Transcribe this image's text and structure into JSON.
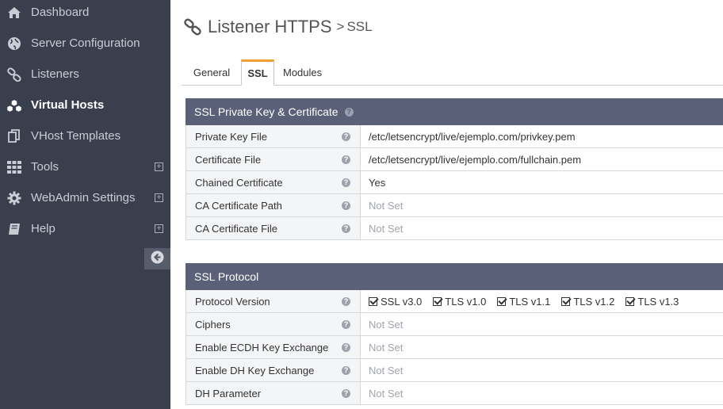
{
  "sidebar": {
    "items": [
      {
        "label": "Dashboard",
        "icon": "home-icon"
      },
      {
        "label": "Server Configuration",
        "icon": "globe-icon"
      },
      {
        "label": "Listeners",
        "icon": "link-icon"
      },
      {
        "label": "Virtual Hosts",
        "icon": "cubes-icon"
      },
      {
        "label": "VHost Templates",
        "icon": "copy-icon"
      },
      {
        "label": "Tools",
        "icon": "grid-icon",
        "expand": "⊞"
      },
      {
        "label": "WebAdmin Settings",
        "icon": "gear-icon",
        "expand": "⊞"
      },
      {
        "label": "Help",
        "icon": "book-icon",
        "expand": "⊞"
      }
    ]
  },
  "header": {
    "title": "Listener HTTPS",
    "separator": ">",
    "subtitle": "SSL"
  },
  "tabs": [
    {
      "label": "General"
    },
    {
      "label": "SSL"
    },
    {
      "label": "Modules"
    }
  ],
  "ssl_key_panel": {
    "title": "SSL Private Key & Certificate",
    "rows": [
      {
        "label": "Private Key File",
        "value": "/etc/letsencrypt/live/ejemplo.com/privkey.pem"
      },
      {
        "label": "Certificate File",
        "value": "/etc/letsencrypt/live/ejemplo.com/fullchain.pem"
      },
      {
        "label": "Chained Certificate",
        "value": "Yes"
      },
      {
        "label": "CA Certificate Path",
        "value": "Not Set"
      },
      {
        "label": "CA Certificate File",
        "value": "Not Set"
      }
    ]
  },
  "ssl_protocol_panel": {
    "title": "SSL Protocol",
    "protocol_label": "Protocol Version",
    "protocols": [
      "SSL v3.0",
      "TLS v1.0",
      "TLS v1.1",
      "TLS v1.2",
      "TLS v1.3"
    ],
    "rows": [
      {
        "label": "Ciphers",
        "value": "Not Set"
      },
      {
        "label": "Enable ECDH Key Exchange",
        "value": "Not Set"
      },
      {
        "label": "Enable DH Key Exchange",
        "value": "Not Set"
      },
      {
        "label": "DH Parameter",
        "value": "Not Set"
      }
    ]
  },
  "help_glyph": "?"
}
